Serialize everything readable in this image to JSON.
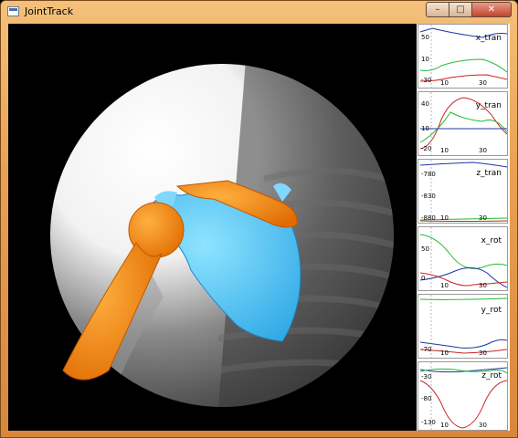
{
  "window": {
    "title": "JointTrack",
    "controls": {
      "minimize": "–",
      "maximize": "□",
      "close": "✕"
    }
  },
  "viewport": {
    "description_icon": "fluoroscopy-shoulder-view"
  },
  "graphs": [
    {
      "name": "x_tran",
      "y_ticks": [
        "50",
        "10",
        "-30"
      ],
      "x_ticks": [
        "10",
        "30"
      ],
      "colors": [
        "#2233aa",
        "#22bb33",
        "#cc2222"
      ]
    },
    {
      "name": "y_tran",
      "y_ticks": [
        "40",
        "10",
        "-20"
      ],
      "x_ticks": [
        "10",
        "30"
      ],
      "colors": [
        "#cc2222",
        "#22bb33",
        "#2233aa"
      ]
    },
    {
      "name": "z_tran",
      "y_ticks": [
        "-780",
        "-830",
        "-880"
      ],
      "x_ticks": [
        "10",
        "30"
      ],
      "colors": [
        "#2233aa",
        "#22bb33",
        "#cc2222"
      ]
    },
    {
      "name": "x_rot",
      "y_ticks": [
        "50",
        "0"
      ],
      "x_ticks": [
        "10",
        "30"
      ],
      "colors": [
        "#22bb33",
        "#2233aa",
        "#cc2222"
      ]
    },
    {
      "name": "y_rot",
      "y_ticks": [
        "-70"
      ],
      "x_ticks": [
        "10",
        "30"
      ],
      "colors": [
        "#22bb33",
        "#2233aa",
        "#cc2222"
      ]
    },
    {
      "name": "z_rot",
      "y_ticks": [
        "-30",
        "-80",
        "-130"
      ],
      "x_ticks": [
        "10",
        "30"
      ],
      "colors": [
        "#2233aa",
        "#22bb33",
        "#cc2222"
      ]
    }
  ]
}
